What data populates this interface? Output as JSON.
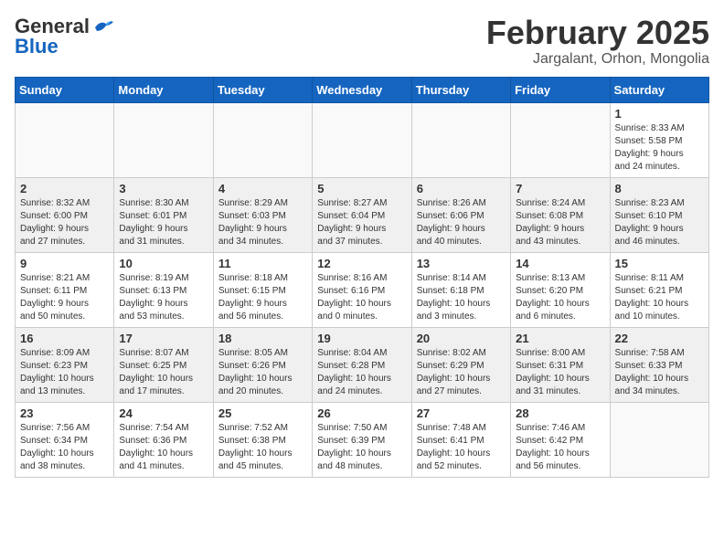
{
  "logo": {
    "line1": "General",
    "line2": "Blue",
    "bird": "🐦"
  },
  "title": "February 2025",
  "subtitle": "Jargalant, Orhon, Mongolia",
  "weekdays": [
    "Sunday",
    "Monday",
    "Tuesday",
    "Wednesday",
    "Thursday",
    "Friday",
    "Saturday"
  ],
  "weeks": [
    [
      {
        "day": "",
        "info": ""
      },
      {
        "day": "",
        "info": ""
      },
      {
        "day": "",
        "info": ""
      },
      {
        "day": "",
        "info": ""
      },
      {
        "day": "",
        "info": ""
      },
      {
        "day": "",
        "info": ""
      },
      {
        "day": "1",
        "info": "Sunrise: 8:33 AM\nSunset: 5:58 PM\nDaylight: 9 hours\nand 24 minutes."
      }
    ],
    [
      {
        "day": "2",
        "info": "Sunrise: 8:32 AM\nSunset: 6:00 PM\nDaylight: 9 hours\nand 27 minutes."
      },
      {
        "day": "3",
        "info": "Sunrise: 8:30 AM\nSunset: 6:01 PM\nDaylight: 9 hours\nand 31 minutes."
      },
      {
        "day": "4",
        "info": "Sunrise: 8:29 AM\nSunset: 6:03 PM\nDaylight: 9 hours\nand 34 minutes."
      },
      {
        "day": "5",
        "info": "Sunrise: 8:27 AM\nSunset: 6:04 PM\nDaylight: 9 hours\nand 37 minutes."
      },
      {
        "day": "6",
        "info": "Sunrise: 8:26 AM\nSunset: 6:06 PM\nDaylight: 9 hours\nand 40 minutes."
      },
      {
        "day": "7",
        "info": "Sunrise: 8:24 AM\nSunset: 6:08 PM\nDaylight: 9 hours\nand 43 minutes."
      },
      {
        "day": "8",
        "info": "Sunrise: 8:23 AM\nSunset: 6:10 PM\nDaylight: 9 hours\nand 46 minutes."
      }
    ],
    [
      {
        "day": "9",
        "info": "Sunrise: 8:21 AM\nSunset: 6:11 PM\nDaylight: 9 hours\nand 50 minutes."
      },
      {
        "day": "10",
        "info": "Sunrise: 8:19 AM\nSunset: 6:13 PM\nDaylight: 9 hours\nand 53 minutes."
      },
      {
        "day": "11",
        "info": "Sunrise: 8:18 AM\nSunset: 6:15 PM\nDaylight: 9 hours\nand 56 minutes."
      },
      {
        "day": "12",
        "info": "Sunrise: 8:16 AM\nSunset: 6:16 PM\nDaylight: 10 hours\nand 0 minutes."
      },
      {
        "day": "13",
        "info": "Sunrise: 8:14 AM\nSunset: 6:18 PM\nDaylight: 10 hours\nand 3 minutes."
      },
      {
        "day": "14",
        "info": "Sunrise: 8:13 AM\nSunset: 6:20 PM\nDaylight: 10 hours\nand 6 minutes."
      },
      {
        "day": "15",
        "info": "Sunrise: 8:11 AM\nSunset: 6:21 PM\nDaylight: 10 hours\nand 10 minutes."
      }
    ],
    [
      {
        "day": "16",
        "info": "Sunrise: 8:09 AM\nSunset: 6:23 PM\nDaylight: 10 hours\nand 13 minutes."
      },
      {
        "day": "17",
        "info": "Sunrise: 8:07 AM\nSunset: 6:25 PM\nDaylight: 10 hours\nand 17 minutes."
      },
      {
        "day": "18",
        "info": "Sunrise: 8:05 AM\nSunset: 6:26 PM\nDaylight: 10 hours\nand 20 minutes."
      },
      {
        "day": "19",
        "info": "Sunrise: 8:04 AM\nSunset: 6:28 PM\nDaylight: 10 hours\nand 24 minutes."
      },
      {
        "day": "20",
        "info": "Sunrise: 8:02 AM\nSunset: 6:29 PM\nDaylight: 10 hours\nand 27 minutes."
      },
      {
        "day": "21",
        "info": "Sunrise: 8:00 AM\nSunset: 6:31 PM\nDaylight: 10 hours\nand 31 minutes."
      },
      {
        "day": "22",
        "info": "Sunrise: 7:58 AM\nSunset: 6:33 PM\nDaylight: 10 hours\nand 34 minutes."
      }
    ],
    [
      {
        "day": "23",
        "info": "Sunrise: 7:56 AM\nSunset: 6:34 PM\nDaylight: 10 hours\nand 38 minutes."
      },
      {
        "day": "24",
        "info": "Sunrise: 7:54 AM\nSunset: 6:36 PM\nDaylight: 10 hours\nand 41 minutes."
      },
      {
        "day": "25",
        "info": "Sunrise: 7:52 AM\nSunset: 6:38 PM\nDaylight: 10 hours\nand 45 minutes."
      },
      {
        "day": "26",
        "info": "Sunrise: 7:50 AM\nSunset: 6:39 PM\nDaylight: 10 hours\nand 48 minutes."
      },
      {
        "day": "27",
        "info": "Sunrise: 7:48 AM\nSunset: 6:41 PM\nDaylight: 10 hours\nand 52 minutes."
      },
      {
        "day": "28",
        "info": "Sunrise: 7:46 AM\nSunset: 6:42 PM\nDaylight: 10 hours\nand 56 minutes."
      },
      {
        "day": "",
        "info": ""
      }
    ]
  ]
}
